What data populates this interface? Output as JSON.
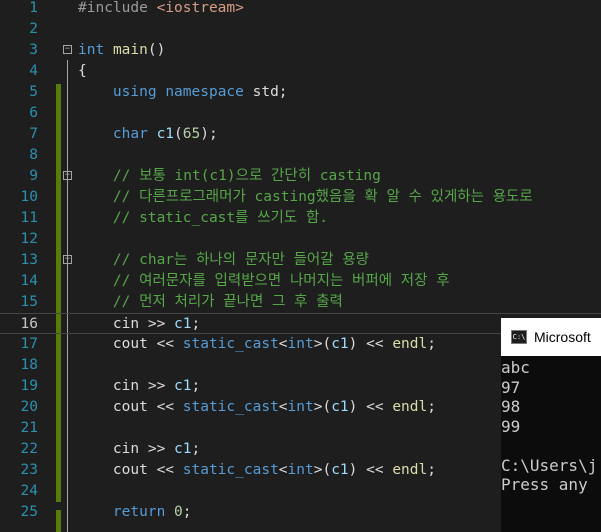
{
  "editor": {
    "lines": [
      {
        "n": "1",
        "tokens": [
          {
            "t": "#include ",
            "c": "pp"
          },
          {
            "t": "<iostream>",
            "c": "p"
          }
        ]
      },
      {
        "n": "2",
        "tokens": []
      },
      {
        "n": "3",
        "fold": true,
        "tokens": [
          {
            "t": "int",
            "c": "k"
          },
          {
            "t": " "
          },
          {
            "t": "main",
            "c": "f"
          },
          {
            "t": "()"
          }
        ]
      },
      {
        "n": "4",
        "tokens": [
          {
            "t": "{"
          }
        ]
      },
      {
        "n": "5",
        "tokens": [
          {
            "t": "    "
          },
          {
            "t": "using",
            "c": "k"
          },
          {
            "t": " "
          },
          {
            "t": "namespace",
            "c": "k"
          },
          {
            "t": " std;"
          }
        ]
      },
      {
        "n": "6",
        "tokens": []
      },
      {
        "n": "7",
        "tokens": [
          {
            "t": "    "
          },
          {
            "t": "char",
            "c": "k"
          },
          {
            "t": " "
          },
          {
            "t": "c1",
            "c": "m"
          },
          {
            "t": "("
          },
          {
            "t": "65",
            "c": "n"
          },
          {
            "t": ");"
          }
        ]
      },
      {
        "n": "8",
        "tokens": []
      },
      {
        "n": "9",
        "fold": true,
        "tokens": [
          {
            "t": "    // 보통 int(c1)으로 간단히 casting",
            "c": "c"
          }
        ]
      },
      {
        "n": "10",
        "tokens": [
          {
            "t": "    // 다른프로그래머가 casting했음을 확 알 수 있게하는 용도로",
            "c": "c"
          }
        ]
      },
      {
        "n": "11",
        "tokens": [
          {
            "t": "    // static_cast를 쓰기도 함.",
            "c": "c"
          }
        ]
      },
      {
        "n": "12",
        "tokens": []
      },
      {
        "n": "13",
        "fold": true,
        "tokens": [
          {
            "t": "    // char는 하나의 문자만 들어갈 용량",
            "c": "c"
          }
        ]
      },
      {
        "n": "14",
        "tokens": [
          {
            "t": "    // 여러문자를 입력받으면 나머지는 버퍼에 저장 후",
            "c": "c"
          }
        ]
      },
      {
        "n": "15",
        "tokens": [
          {
            "t": "    // 먼저 처리가 끝나면 그 후 출력",
            "c": "c"
          }
        ]
      },
      {
        "n": "16",
        "current": true,
        "tokens": [
          {
            "t": "    cin >> "
          },
          {
            "t": "c1",
            "c": "m"
          },
          {
            "t": ";"
          }
        ]
      },
      {
        "n": "17",
        "tokens": [
          {
            "t": "    cout << "
          },
          {
            "t": "static_cast",
            "c": "k"
          },
          {
            "t": "<"
          },
          {
            "t": "int",
            "c": "k"
          },
          {
            "t": ">("
          },
          {
            "t": "c1",
            "c": "m"
          },
          {
            "t": ") << "
          },
          {
            "t": "endl",
            "c": "f"
          },
          {
            "t": ";"
          }
        ]
      },
      {
        "n": "18",
        "tokens": []
      },
      {
        "n": "19",
        "tokens": [
          {
            "t": "    cin >> "
          },
          {
            "t": "c1",
            "c": "m"
          },
          {
            "t": ";"
          }
        ]
      },
      {
        "n": "20",
        "tokens": [
          {
            "t": "    cout << "
          },
          {
            "t": "static_cast",
            "c": "k"
          },
          {
            "t": "<"
          },
          {
            "t": "int",
            "c": "k"
          },
          {
            "t": ">("
          },
          {
            "t": "c1",
            "c": "m"
          },
          {
            "t": ") << "
          },
          {
            "t": "endl",
            "c": "f"
          },
          {
            "t": ";"
          }
        ]
      },
      {
        "n": "21",
        "tokens": []
      },
      {
        "n": "22",
        "tokens": [
          {
            "t": "    cin >> "
          },
          {
            "t": "c1",
            "c": "m"
          },
          {
            "t": ";"
          }
        ]
      },
      {
        "n": "23",
        "tokens": [
          {
            "t": "    cout << "
          },
          {
            "t": "static_cast",
            "c": "k"
          },
          {
            "t": "<"
          },
          {
            "t": "int",
            "c": "k"
          },
          {
            "t": ">("
          },
          {
            "t": "c1",
            "c": "m"
          },
          {
            "t": ") << "
          },
          {
            "t": "endl",
            "c": "f"
          },
          {
            "t": ";"
          }
        ]
      },
      {
        "n": "24",
        "tokens": []
      },
      {
        "n": "25",
        "tokens": [
          {
            "t": "    "
          },
          {
            "t": "return",
            "c": "k"
          },
          {
            "t": " "
          },
          {
            "t": "0",
            "c": "n"
          },
          {
            "t": ";"
          }
        ]
      }
    ],
    "fold_icon": "minus-box-icon"
  },
  "console": {
    "title": "Microsoft",
    "icon": "console-app-icon",
    "icon_text": "C:\\",
    "output_lines": [
      "abc",
      "97",
      "98",
      "99",
      "",
      "C:\\Users\\j",
      "Press any"
    ]
  },
  "colors": {
    "background": "#1e1e1e",
    "line_number": "#2b91af",
    "keyword": "#569cd6",
    "comment": "#57a64a",
    "change_bar": "#587c0c"
  }
}
